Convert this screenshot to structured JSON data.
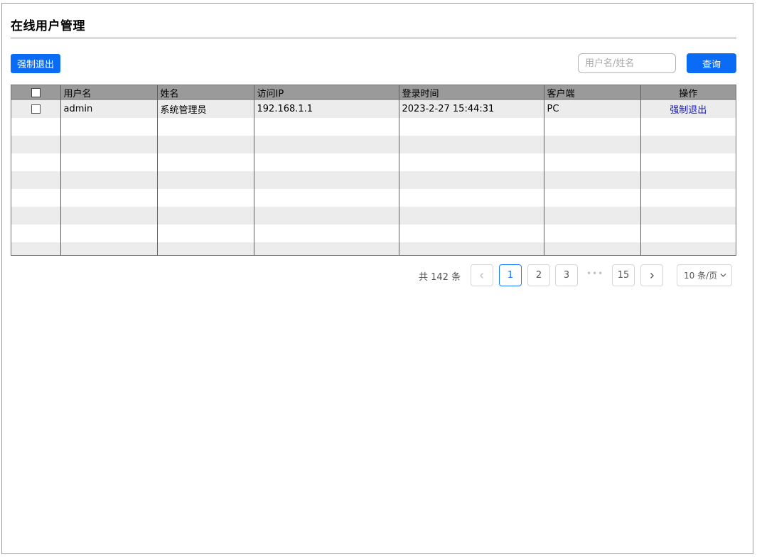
{
  "header": {
    "title": "在线用户管理"
  },
  "toolbar": {
    "force_logout_label": "强制退出",
    "search_placeholder": "用户名/姓名",
    "search_value": "",
    "query_label": "查询"
  },
  "table": {
    "columns": [
      "用户名",
      "姓名",
      "访问IP",
      "登录时间",
      "客户端",
      "操作"
    ],
    "rows": [
      {
        "username": "admin",
        "name": "系统管理员",
        "ip": "192.168.1.1",
        "login_time": "2023-2-27 15:44:31",
        "client": "PC",
        "action": "强制退出"
      }
    ]
  },
  "pagination": {
    "total_text": "共 142 条",
    "prev_icon": "chevron-left-icon",
    "pages": [
      "1",
      "2",
      "3"
    ],
    "current_page": "1",
    "ellipsis": "•••",
    "last_page": "15",
    "next_icon": "chevron-right-icon",
    "page_size_label": "10 条/页",
    "page_size_icon": "chevron-down-icon"
  },
  "colors": {
    "primary": "#0a6cf5",
    "header_bg": "#9a9a9a",
    "row_alt": "#ececec",
    "link": "#1a1ab8",
    "active_page": "#1677ff"
  }
}
